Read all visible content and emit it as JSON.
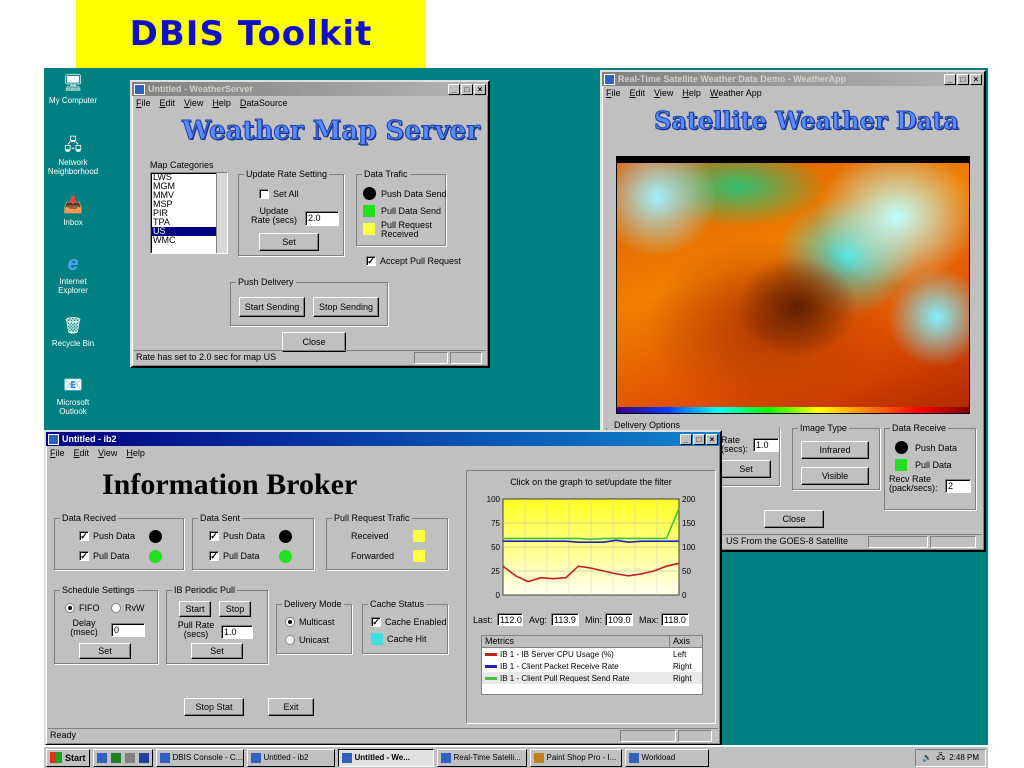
{
  "banner": {
    "title": "DBIS Toolkit"
  },
  "desktop_icons": [
    {
      "label": "My Computer",
      "icon": "computer-icon"
    },
    {
      "label": "Network Neighborhood",
      "icon": "network-icon"
    },
    {
      "label": "Inbox",
      "icon": "inbox-icon"
    },
    {
      "label": "Internet Explorer",
      "icon": "ie-icon"
    },
    {
      "label": "Recycle Bin",
      "icon": "recycle-icon"
    },
    {
      "label": "Microsoft Outlook",
      "icon": "outlook-icon"
    }
  ],
  "weather_server": {
    "title": "Untitled - WeatherServer",
    "menu": [
      "File",
      "Edit",
      "View",
      "Help",
      "DataSource"
    ],
    "heading": "Weather Map Server",
    "map_categories_label": "Map Categories",
    "map_categories": [
      "LWS",
      "MGM",
      "MMV",
      "MSP",
      "PIR",
      "TPA",
      "US",
      "WMC"
    ],
    "selected_category": "US",
    "update_rate_group": "Update Rate Setting",
    "set_all": "Set All",
    "update_rate_label": "Update Rate (secs)",
    "update_rate_value": "2.0",
    "set": "Set",
    "data_traffic_group": "Data Trafic",
    "push_data_send": "Push Data Send",
    "pull_data_send": "Pull Data Send",
    "pull_request_received": "Pull Request Received",
    "accept_pull_request": "Accept Pull Request",
    "push_delivery_group": "Push Delivery",
    "start_sending": "Start Sending",
    "stop_sending": "Stop Sending",
    "close": "Close",
    "status": "Rate has set to 2.0 sec for map US"
  },
  "weather_app": {
    "title": "Real-Time Satellite Weather Data Demo - WeatherApp",
    "menu": [
      "File",
      "Edit",
      "View",
      "Help",
      "Weather App"
    ],
    "heading": "Satellite Weather Data",
    "delivery_options_group": "Delivery Options",
    "rate_label": "Rate (secs):",
    "rate_value": "1.0",
    "set": "Set",
    "image_type_group": "Image Type",
    "infrared": "Infrared",
    "visible": "Visible",
    "data_receive_group": "Data Receive",
    "push_data": "Push Data",
    "pull_data": "Pull Data",
    "recv_rate_label": "Recv Rate (pack/secs):",
    "recv_rate_value": "2",
    "close": "Close",
    "status": "US From the GOES-8 Satellite"
  },
  "broker": {
    "title": "Untitled - ib2",
    "menu": [
      "File",
      "Edit",
      "View",
      "Help"
    ],
    "heading": "Information Broker",
    "data_received_group": "Data Recived",
    "push_data": "Push Data",
    "pull_data": "Pull Data",
    "data_sent_group": "Data Sent",
    "pull_request_group": "Pull Request Trafic",
    "received": "Received",
    "forwarded": "Forwarded",
    "schedule_group": "Schedule Settings",
    "fifo": "FIFO",
    "rw": "RvW",
    "delay_label": "Delay (msec)",
    "delay_value": "0",
    "set": "Set",
    "periodic_group": "IB Periodic Pull",
    "start": "Start",
    "stop": "Stop",
    "pull_rate_label": "Pull Rate (secs)",
    "pull_rate_value": "1.0",
    "delivery_mode_group": "Delivery Mode",
    "multicast": "Multicast",
    "unicast": "Unicast",
    "cache_group": "Cache Status",
    "cache_enabled": "Cache Enabled",
    "cache_hit": "Cache Hit",
    "stop_stat": "Stop Stat",
    "exit": "Exit",
    "status": "Ready",
    "graph": {
      "hint": "Click on the graph to set/update the filter",
      "last_label": "Last:",
      "last": "112.0",
      "avg_label": "Avg:",
      "avg": "113.9",
      "min_label": "Min:",
      "min": "109.0",
      "max_label": "Max:",
      "max": "118.0",
      "metrics_header": "Metrics",
      "axis_header": "Axis",
      "metrics": [
        {
          "name": "IB 1 - IB Server CPU Usage (%)",
          "axis": "Left",
          "color": "#c02020"
        },
        {
          "name": "IB 1 - Client Packet Receive Rate",
          "axis": "Right",
          "color": "#2020c0"
        },
        {
          "name": "IB 1 - Client Pull Request Send Rate",
          "axis": "Right",
          "color": "#40c040"
        }
      ]
    }
  },
  "chart_data": {
    "type": "line",
    "x": [
      0,
      1,
      2,
      3,
      4,
      5,
      6,
      7,
      8,
      9,
      10,
      11,
      12,
      13,
      14
    ],
    "left_ticks": [
      "100",
      "75",
      "50",
      "25",
      "0"
    ],
    "right_ticks": [
      "200",
      "150",
      "100",
      "50",
      "0"
    ],
    "ylim_left": [
      0,
      100
    ],
    "ylim_right": [
      0,
      200
    ],
    "series": [
      {
        "name": "IB 1 - IB Server CPU Usage (%)",
        "axis": "left",
        "color": "#c02020",
        "values": [
          30,
          20,
          14,
          18,
          17,
          18,
          30,
          28,
          25,
          22,
          20,
          22,
          25,
          30,
          33
        ]
      },
      {
        "name": "IB 1 - Client Packet Receive Rate",
        "axis": "right",
        "color": "#2020c0",
        "values": [
          112,
          112,
          112,
          112,
          112,
          112,
          110,
          110,
          110,
          114,
          110,
          112,
          112,
          112,
          112
        ]
      },
      {
        "name": "IB 1 - Client Pull Request Send Rate",
        "axis": "right",
        "color": "#40c040",
        "values": [
          118,
          118,
          118,
          118,
          118,
          118,
          118,
          116,
          118,
          118,
          118,
          118,
          118,
          118,
          180
        ]
      }
    ]
  },
  "taskbar": {
    "start": "Start",
    "items": [
      "DBIS Console - C...",
      "Untitled - ib2",
      "Untitled - We...",
      "Real-Time Satelli...",
      "Paint Shop Pro - I...",
      "Workload"
    ],
    "active_index": 2,
    "clock": "2:48 PM"
  }
}
